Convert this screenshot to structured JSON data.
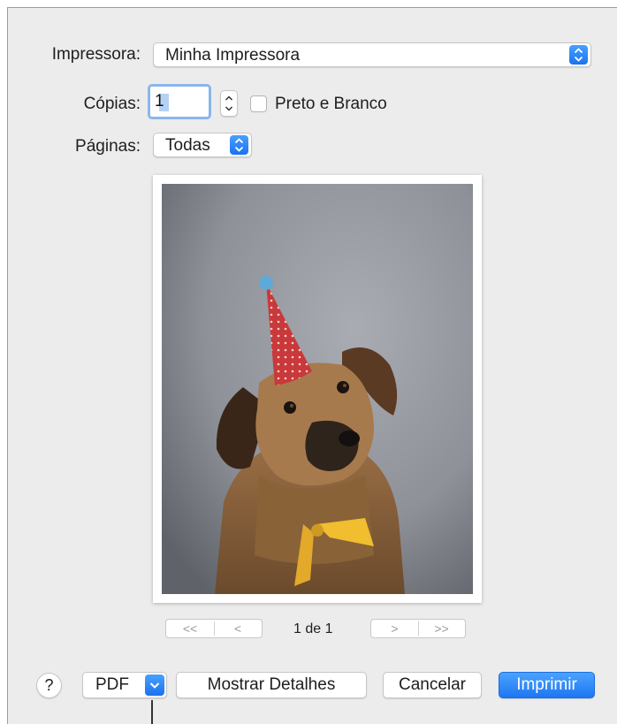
{
  "printer": {
    "label": "Impressora:",
    "value": "Minha Impressora"
  },
  "copies": {
    "label": "Cópias:",
    "value": "1",
    "bw_label": "Preto e Branco",
    "bw_checked": false
  },
  "pages": {
    "label": "Páginas:",
    "value": "Todas"
  },
  "preview": {
    "subject": "dog-with-party-hat-photo"
  },
  "pager": {
    "first": "<<",
    "prev": "<",
    "next": ">",
    "last": ">>",
    "label": "1 de 1"
  },
  "footer": {
    "help": "?",
    "pdf": "PDF",
    "details": "Mostrar Detalhes",
    "cancel": "Cancelar",
    "print": "Imprimir"
  },
  "colors": {
    "accent": "#1f76f2",
    "dialog_bg": "#ececec"
  }
}
